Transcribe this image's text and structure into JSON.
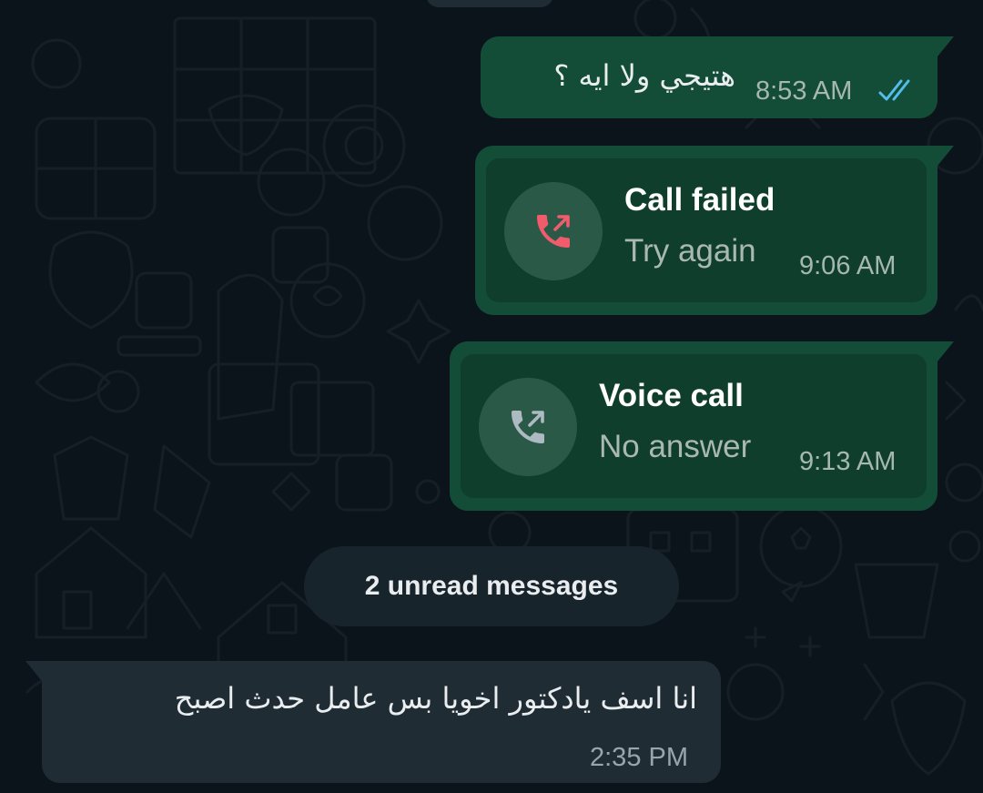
{
  "messages": [
    {
      "direction": "outgoing",
      "type": "text",
      "text": "هتيجي ولا ايه ؟",
      "time": "8:53 AM",
      "status_icon": "double-check-read-icon"
    },
    {
      "direction": "outgoing",
      "type": "call",
      "call_title": "Call failed",
      "call_subtitle": "Try again",
      "time": "9:06 AM",
      "call_icon": "phone-outgoing-failed-icon"
    },
    {
      "direction": "outgoing",
      "type": "call",
      "call_title": "Voice call",
      "call_subtitle": "No answer",
      "time": "9:13 AM",
      "call_icon": "phone-outgoing-icon"
    },
    {
      "direction": "incoming",
      "type": "text",
      "text": "انا اسف يادكتور اخويا بس عامل حدث اصبح",
      "time": "2:35 PM"
    }
  ],
  "unread_divider": {
    "label": "2 unread messages"
  },
  "colors": {
    "background": "#0b141a",
    "outgoing_bubble": "#144d37",
    "incoming_bubble": "#202c33",
    "read_ticks": "#53bdeb",
    "failed_call": "#f15c6d",
    "call_icon_gray": "#aebac1"
  }
}
